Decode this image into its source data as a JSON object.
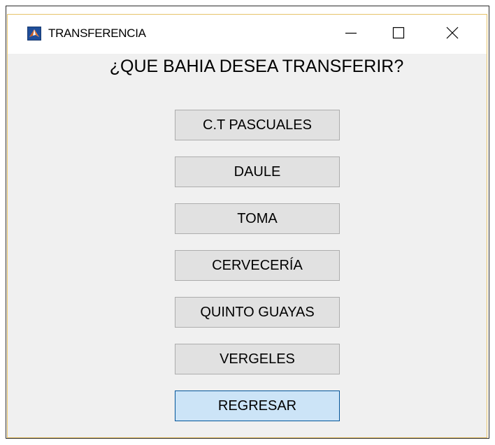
{
  "window": {
    "title": "TRANSFERENCIA",
    "icon": "matlab-logo-icon",
    "controls": {
      "minimize": "minimize-icon",
      "maximize": "maximize-icon",
      "close": "close-icon"
    }
  },
  "main": {
    "question": "¿QUE BAHIA DESEA TRANSFERIR?",
    "buttons": [
      {
        "label": "C.T PASCUALES"
      },
      {
        "label": "DAULE"
      },
      {
        "label": "TOMA"
      },
      {
        "label": "CERVECERÍA"
      },
      {
        "label": "QUINTO GUAYAS"
      },
      {
        "label": "VERGELES"
      }
    ],
    "back_button": "REGRESAR"
  },
  "colors": {
    "accent": "#005499",
    "button_face": "#e1e1e1",
    "button_selected": "#cce4f7",
    "window_border": "#e6c36a"
  }
}
